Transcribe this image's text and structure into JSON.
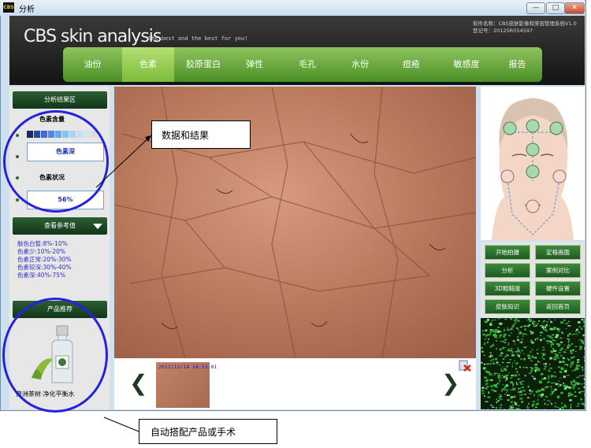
{
  "window": {
    "title": "分析",
    "app_icon": "CBS",
    "controls": {
      "minimize": "—",
      "maximize": "□",
      "close": "✕"
    }
  },
  "header": {
    "brand": "CBS skin analysis",
    "tagline": "The best and the best for you!",
    "soft_name": "软件名称：CBS皮肤影像和美容管理系统V1.0",
    "reg_no": "登记号：2012SR054597"
  },
  "nav": {
    "tabs": [
      {
        "label": "油份"
      },
      {
        "label": "色素"
      },
      {
        "label": "胶原蛋白"
      },
      {
        "label": "弹性"
      },
      {
        "label": "毛孔"
      },
      {
        "label": "水份"
      },
      {
        "label": "痘疮"
      },
      {
        "label": "敏感度"
      },
      {
        "label": "报告"
      }
    ],
    "active_index": 1
  },
  "left": {
    "results_header": "分析结果区",
    "section1_label": "色素含量",
    "pigment_level": "色素深",
    "section2_label": "色素状况",
    "pigment_value": "56%",
    "swatch_colors": [
      "#1a2a5c",
      "#2a4aa0",
      "#3d6bd4",
      "#4f88e6",
      "#6aa7ef",
      "#89c1f2",
      "#a8d4f5",
      "#c2dff5",
      "#d4e3ee",
      "#dadde0"
    ],
    "ref_header": "查看参考值",
    "ref_values": [
      "肤色白皙:8%-10%",
      "色素少:10%-20%",
      "色素正常:20%-30%",
      "色素较深:30%-40%",
      "色素深:40%-75%"
    ],
    "product_header": "产品推荐",
    "product_name": "爽洲茶树·净化平衡水"
  },
  "viewer": {
    "thumb_date": "2012/12/14 14:53:01",
    "prev": "❮",
    "next": "❯"
  },
  "right": {
    "buttons": [
      "开始拍摄",
      "定格画面",
      "分析",
      "案例对比",
      "3D粗糙度",
      "硬件设置",
      "皮肤知识",
      "返回首页"
    ]
  },
  "annotations": {
    "callout_results": "数据和结果",
    "callout_product": "自动搭配产品或手术",
    "circle_color": "#2222e0"
  }
}
